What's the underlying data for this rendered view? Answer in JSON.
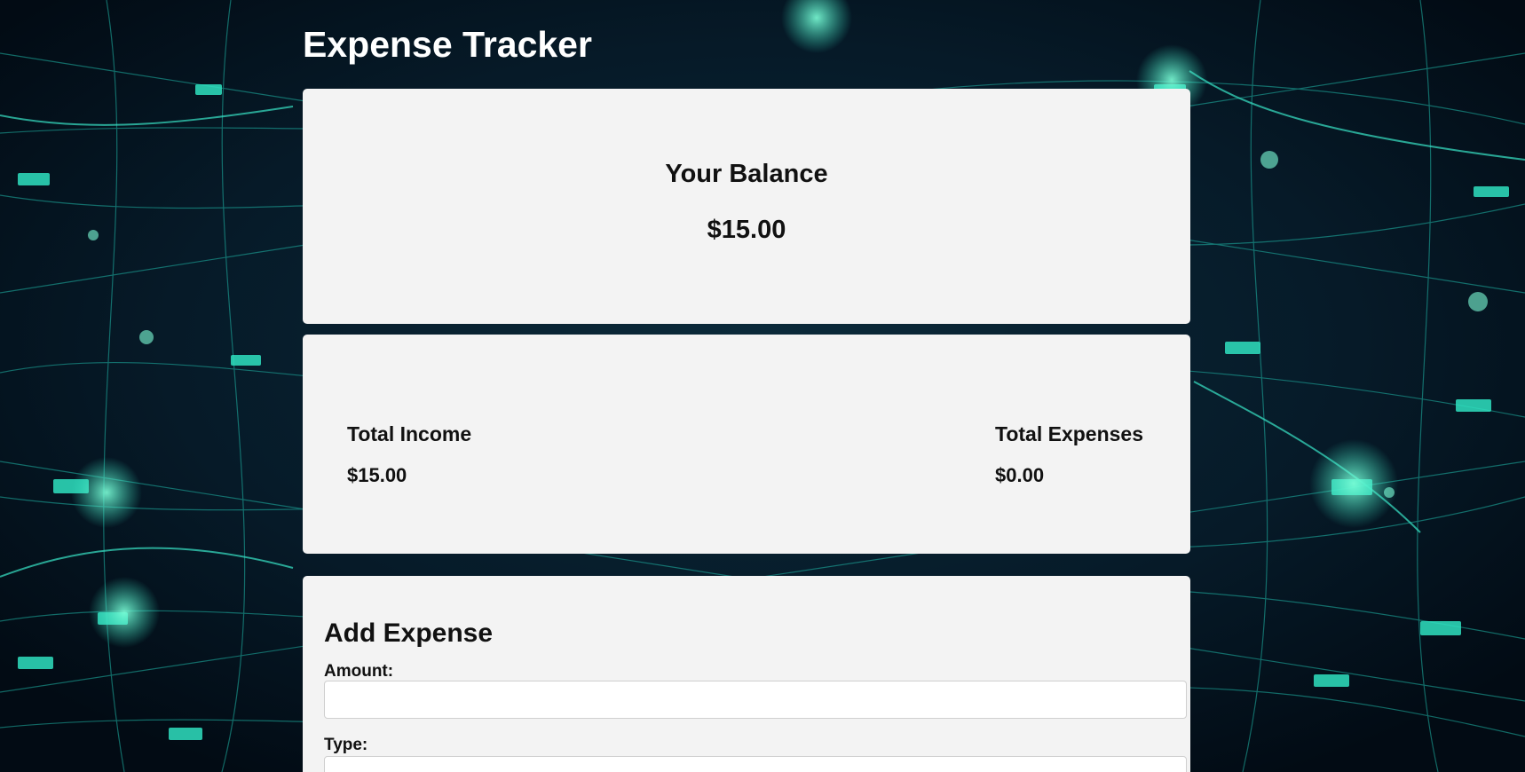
{
  "app": {
    "title": "Expense Tracker"
  },
  "balance": {
    "heading": "Your Balance",
    "value": "$15.00"
  },
  "totals": {
    "income_label": "Total Income",
    "income_value": "$15.00",
    "expenses_label": "Total Expenses",
    "expenses_value": "$0.00"
  },
  "add_expense": {
    "title": "Add Expense",
    "amount_label": "Amount:",
    "amount_value": "",
    "type_label": "Type:",
    "type_value": ""
  },
  "colors": {
    "background": "#03101c",
    "card": "#f3f3f3",
    "title_text": "#ffffff",
    "accent_glow": "#2fe0c0"
  }
}
